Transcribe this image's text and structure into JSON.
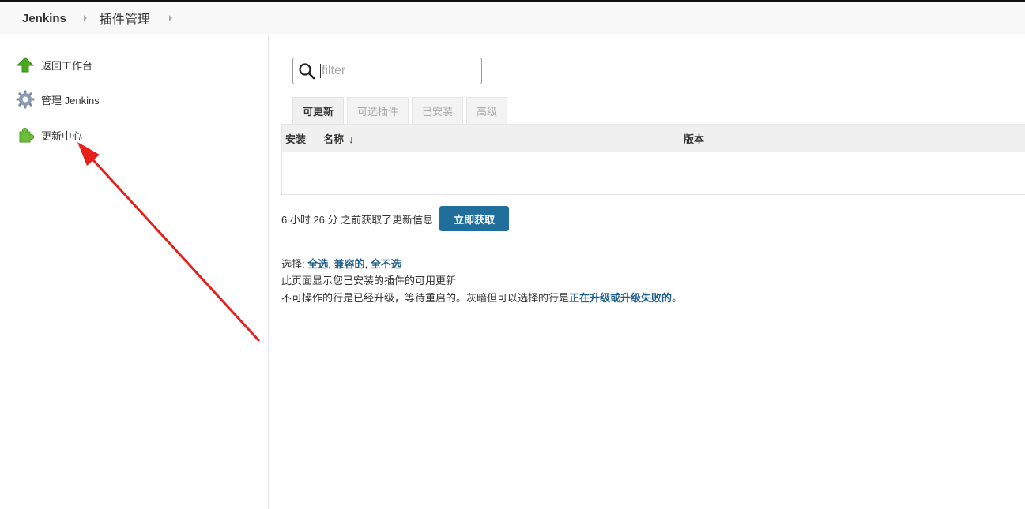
{
  "breadcrumb": {
    "items": [
      "Jenkins",
      "插件管理"
    ]
  },
  "sidebar": {
    "items": [
      {
        "label": "返回工作台",
        "icon": "up-arrow-icon",
        "color": "#4aa81f"
      },
      {
        "label": "管理 Jenkins",
        "icon": "gear-icon",
        "color": "#7a8aa0"
      },
      {
        "label": "更新中心",
        "icon": "puzzle-icon",
        "color": "#6cbf3a"
      }
    ]
  },
  "search": {
    "placeholder": "filter"
  },
  "tabs": [
    {
      "label": "可更新",
      "active": true
    },
    {
      "label": "可选插件",
      "active": false
    },
    {
      "label": "已安装",
      "active": false
    },
    {
      "label": "高级",
      "active": false
    }
  ],
  "table": {
    "headers": {
      "install": "安装",
      "name": "名称",
      "sort_indicator": "↓",
      "version": "版本"
    },
    "rows": []
  },
  "update": {
    "text": "6 小时 26 分 之前获取了更新信息",
    "button_label": "立即获取"
  },
  "selection": {
    "prefix": "选择: ",
    "all": "全选",
    "compatible": "兼容的",
    "none": "全不选",
    "sep": ", "
  },
  "description": {
    "line1": "此页面显示您已安装的插件的可用更新",
    "line2_prefix": "不可操作的行是已经升级，等待重启的。灰暗但可以选择的行是",
    "line2_strong": "正在升级或升级失败的",
    "line2_suffix": "。"
  },
  "colors": {
    "accent": "#1f6e9c",
    "link": "#1f5f8a",
    "annotation_arrow": "#e8201c"
  }
}
